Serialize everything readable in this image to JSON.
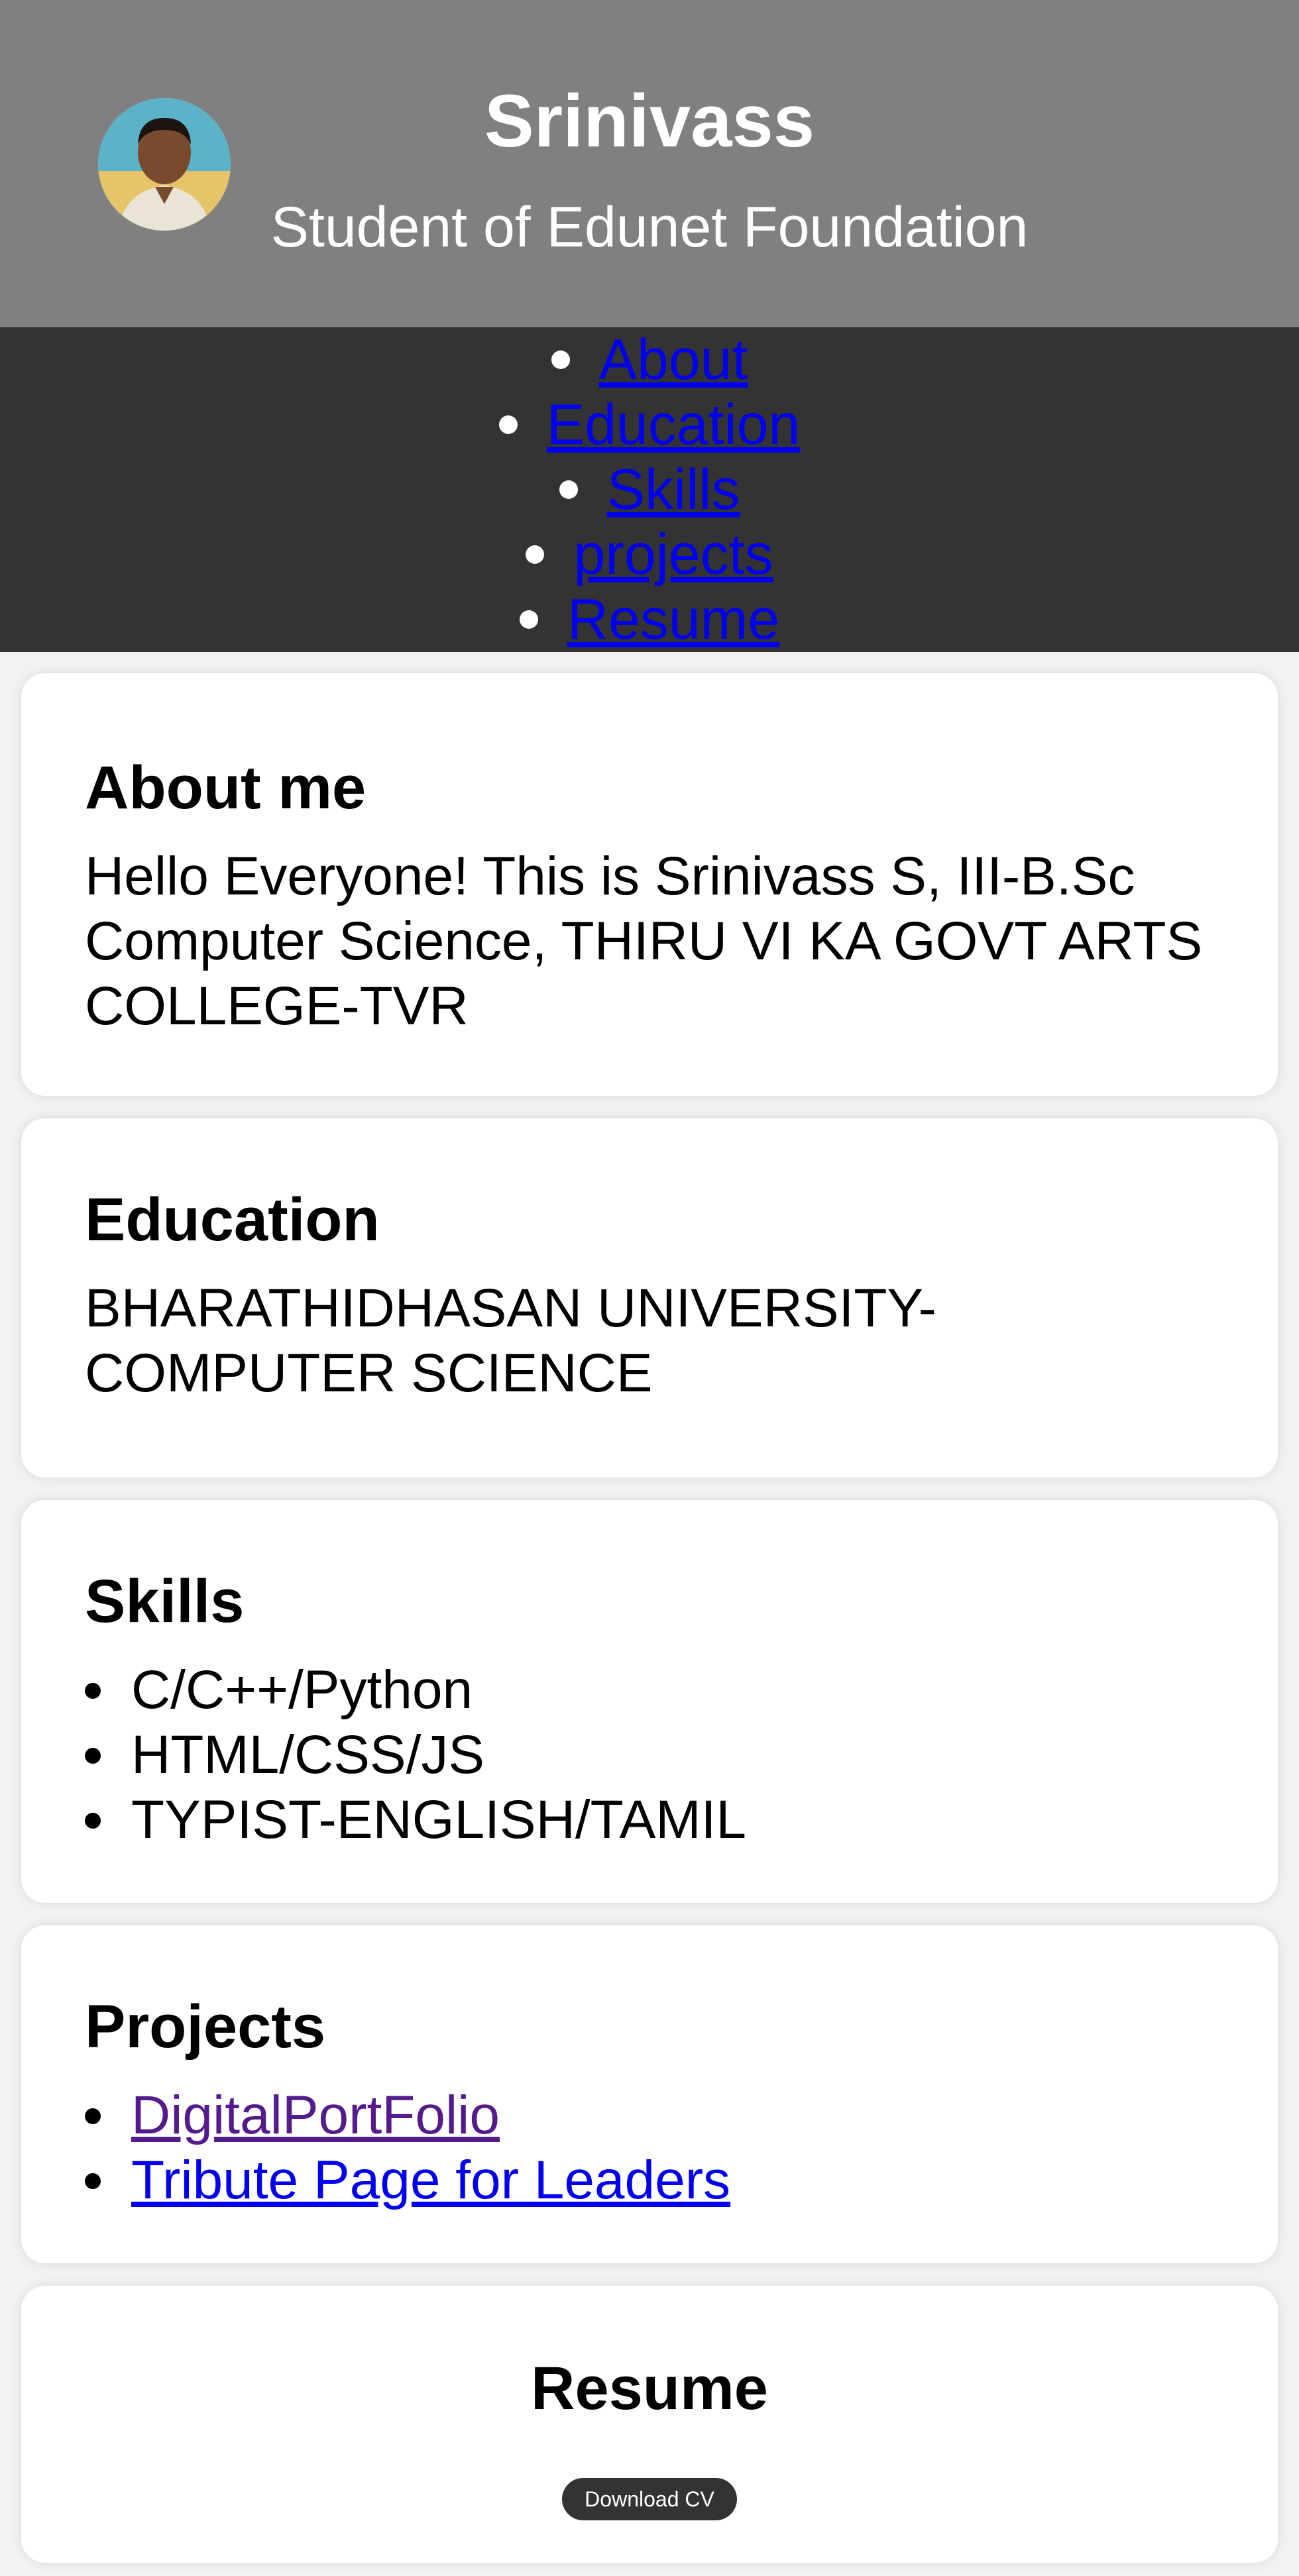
{
  "header": {
    "name": "Srinivass",
    "tagline": "Student of Edunet Foundation",
    "avatar_icon": "profile-photo"
  },
  "nav": {
    "items": [
      "About",
      "Education",
      "Skills",
      "projects",
      "Resume"
    ]
  },
  "about": {
    "title": "About me",
    "text": "Hello Everyone! This is Srinivass S, III-B.Sc Computer Science, THIRU VI KA GOVT ARTS COLLEGE-TVR"
  },
  "education": {
    "title": "Education",
    "text": "BHARATHIDHASAN UNIVERSITY-COMPUTER SCIENCE"
  },
  "skills": {
    "title": "Skills",
    "items": [
      "C/C++/Python",
      "HTML/CSS/JS",
      "TYPIST-ENGLISH/TAMIL"
    ]
  },
  "projects": {
    "title": "Projects",
    "items": [
      "DigitalPortFolio",
      "Tribute Page for Leaders"
    ]
  },
  "resume": {
    "title": "Resume",
    "button_label": "Download CV"
  },
  "colors": {
    "header_bg": "#808080",
    "nav_bg": "#333333",
    "page_bg": "#f2f2f2",
    "link": "#0000ee",
    "visited_link": "#551a8b",
    "button_bg": "#333333"
  }
}
